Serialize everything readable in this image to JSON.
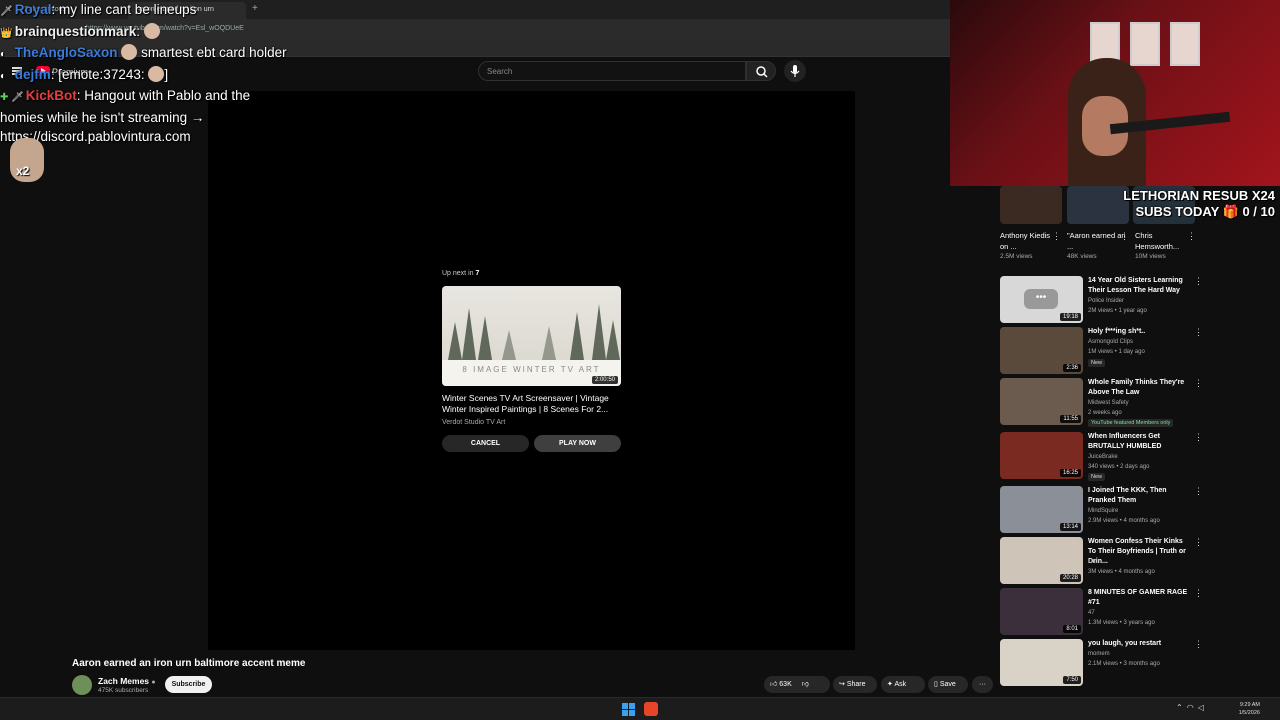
{
  "browser": {
    "tab1_label": "Subscriptions",
    "tab2_label": "Aaron earned an iron urn",
    "new_tab": "+",
    "url": "https://www.youtube.com/watch?v=Esl_wOQDUeE"
  },
  "yt_header": {
    "premium_label": "Premium",
    "search_placeholder": "Search"
  },
  "player": {
    "upnext_prefix": "Up next in ",
    "upnext_seconds": "7",
    "thumb_caption": "8 IMAGE WINTER TV ART",
    "thumb_duration": "2:00:50",
    "title": "Winter Scenes TV Art Screensaver | Vintage Winter Inspired Paintings | 8 Scenes For 2...",
    "channel": "Verdot Studio TV Art",
    "cancel_label": "CANCEL",
    "play_now_label": "PLAY NOW"
  },
  "video": {
    "title": "Aaron earned an iron urn baltimore accent meme",
    "channel": "Zach Memes",
    "subscribers": "475K subscribers",
    "subscribe_label": "Subscribe",
    "likes": "63K",
    "share_label": "Share",
    "ask_label": "Ask",
    "save_label": "Save",
    "more_label": "···"
  },
  "chat": [
    {
      "user": "Royal",
      "text": ": my line cant be lineups",
      "color": "#3b7bd8"
    },
    {
      "user": "brainquestionmark",
      "text": ":",
      "color": "#eeeeee"
    },
    {
      "user": "TheAngloSaxon",
      "text": "smartest ebt card holder",
      "color": "#3b7bd8"
    },
    {
      "user": "dejfm",
      "text": ": [emote:37243:",
      "tail": "]",
      "color": "#3b7bd8"
    },
    {
      "user": "KickBot",
      "text": ": Hangout with Pablo and the",
      "color": "#e24040"
    }
  ],
  "chat_cont": [
    "homies while he isn't streaming →",
    "https://discord.pablovintura.com"
  ],
  "chat_x2": "x2",
  "sub_alert": {
    "line1": "LETHORIAN RESUB X24",
    "line2": "SUBS TODAY 🎁 0 / 10"
  },
  "shorts": [
    {
      "title": "Anthony Kiedis on ...",
      "views": "2.5M views"
    },
    {
      "title": "\"Aaron earned an ...",
      "views": "48K views"
    },
    {
      "title": "Chris Hemsworth...",
      "views": "10M views"
    }
  ],
  "recommendations": [
    {
      "title": "14 Year Old Sisters Learning Their Lesson The Hard Way",
      "channel": "Police Insider",
      "meta": "2M views • 1 year ago",
      "duration": "19:18",
      "badge": ""
    },
    {
      "title": "Holy f***ing sh*t..",
      "channel": "Asmongold Clips",
      "meta": "1M views • 1 day ago",
      "duration": "2:36",
      "badge": "New"
    },
    {
      "title": "Whole Family Thinks They're Above The Law",
      "channel": "Midwest Safety",
      "meta": "2 weeks ago",
      "duration": "11:55",
      "badge": "YouTube featured  Members only"
    },
    {
      "title": "When Influencers Get BRUTALLY HUMBLED",
      "channel": "JuiceBrake",
      "meta": "340 views • 2 days ago",
      "duration": "16:25",
      "badge": "New"
    },
    {
      "title": "I Joined The KKK, Then Pranked Them",
      "channel": "MindSquire",
      "meta": "2.9M views • 4 months ago",
      "duration": "13:14",
      "badge": ""
    },
    {
      "title": "Women Confess Their Kinks To Their Boyfriends | Truth or Drin...",
      "channel": "Cut",
      "meta": "3M views • 4 months ago",
      "duration": "20:28",
      "badge": ""
    },
    {
      "title": "8 MINUTES OF GAMER RAGE #71",
      "channel": "47",
      "meta": "1.3M views • 3 years ago",
      "duration": "8:01",
      "badge": ""
    },
    {
      "title": "you laugh, you restart",
      "channel": "momem",
      "meta": "2.1M views • 3 months ago",
      "duration": "7:50",
      "badge": ""
    }
  ],
  "taskbar": {
    "time": "9:29 AM",
    "date": "1/5/2026"
  }
}
